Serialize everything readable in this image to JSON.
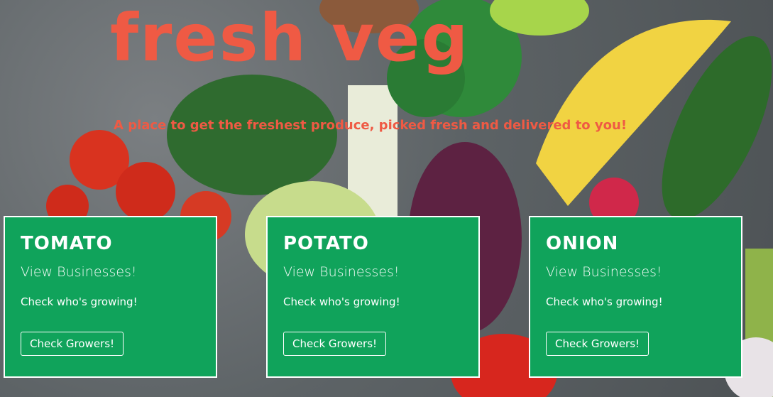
{
  "hero": {
    "title": "fresh veg",
    "subtitle": "A place to get the freshest produce, picked fresh and delivered to you!"
  },
  "cards": [
    {
      "title": "TOMATO",
      "subtitle": "View Businesses!",
      "text": "Check who's growing!",
      "button_label": "Check Growers!"
    },
    {
      "title": "POTATO",
      "subtitle": "View Businesses!",
      "text": "Check who's growing!",
      "button_label": "Check Growers!"
    },
    {
      "title": "ONION",
      "subtitle": "View Businesses!",
      "text": "Check who's growing!",
      "button_label": "Check Growers!"
    }
  ],
  "colors": {
    "title": "#ef5a44",
    "card_bg": "#10a35b",
    "card_border": "#ffffff"
  }
}
